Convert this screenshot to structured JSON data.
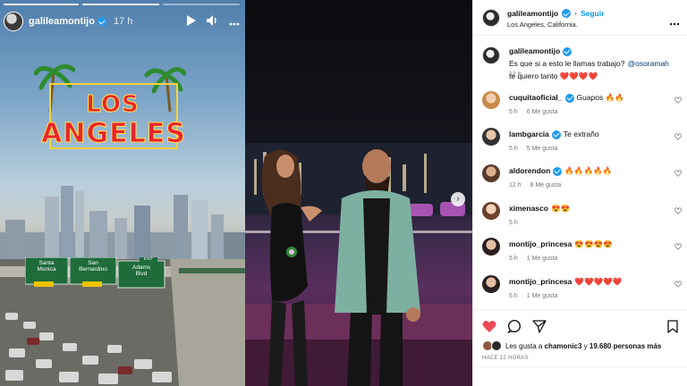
{
  "story": {
    "username": "galileamontijo",
    "time": "17 h",
    "logo_line1": "LOS",
    "logo_line2": "ANGELES",
    "sign_left_line1": "Santa",
    "sign_left_line2": "Monica",
    "sign_mid_line1": "San",
    "sign_mid_line2": "Bernardino",
    "sign_right_line1": "Adams",
    "sign_right_line2": "Blvd",
    "sign_exit": "EXIT"
  },
  "post": {
    "username": "galileamontijo",
    "follow_label": "Seguir",
    "location": "Los Angeles, California.",
    "caption_user": "galileamontijo",
    "caption_text": "Es que si a esto le llamas trabajo?",
    "caption_mention": "@osoramah",
    "caption_text2": "te quiero tanto ❤️❤️❤️❤️",
    "caption_time": "12 h"
  },
  "comments": [
    {
      "user": "cuquitaoficial_",
      "verified": true,
      "text": "Guapos 🔥🔥",
      "time": "5 h",
      "likes": "6 Me gusta"
    },
    {
      "user": "lambgarcia",
      "verified": true,
      "text": "Te extraño",
      "time": "5 h",
      "likes": "5 Me gusta"
    },
    {
      "user": "aldorendon",
      "verified": true,
      "text": "🔥🔥🔥🔥🔥",
      "time": "12 h",
      "likes": "8 Me gusta"
    },
    {
      "user": "ximenasco",
      "verified": false,
      "text": "😍😍",
      "time": "5 h",
      "likes": ""
    },
    {
      "user": "montijo_princesa",
      "verified": false,
      "text": "😍😍😍😍",
      "time": "5 h",
      "likes": "1 Me gusta"
    },
    {
      "user": "montijo_princesa",
      "verified": false,
      "text": "❤️❤️❤️❤️❤️",
      "time": "5 h",
      "likes": "1 Me gusta"
    }
  ],
  "footer": {
    "likes_prefix": "Les gusta a",
    "likes_user": "chamonic3",
    "likes_mid": "y",
    "likes_count": "19.680 personas más",
    "posted_ago": "HACE 12 HORAS"
  },
  "icons": {
    "play": "play-icon",
    "volume": "volume-icon",
    "more": "more-icon",
    "like": "heart-icon",
    "comment": "comment-icon",
    "share": "share-icon"
  },
  "colors": {
    "follow": "#0095f6",
    "like": "#ed4956",
    "verified": "#1f9bf0"
  }
}
